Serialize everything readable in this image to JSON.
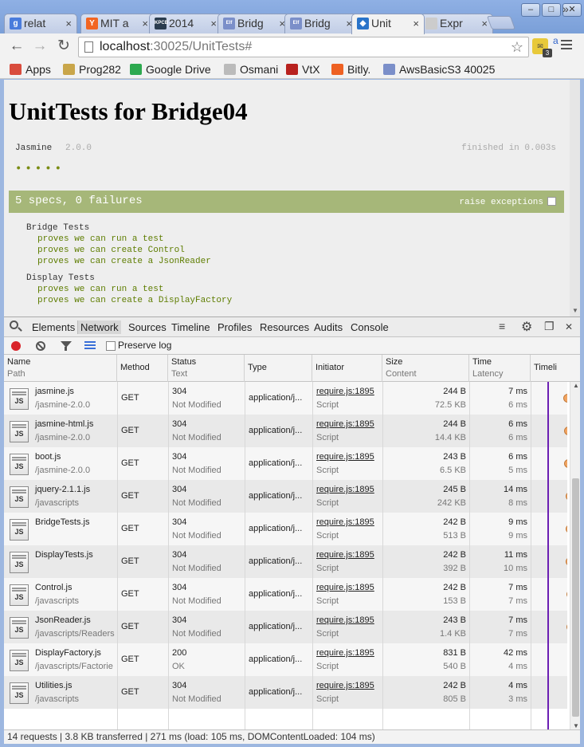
{
  "window": {
    "minimize_glyph": "–",
    "maximize_glyph": "□",
    "close_glyph": "✕"
  },
  "tabs": [
    {
      "label": "relat",
      "favicon": "g",
      "favicon_color": "#4a7cdc",
      "active": false
    },
    {
      "label": "MIT a",
      "favicon": "Y",
      "favicon_color": "#f26522",
      "active": false
    },
    {
      "label": "2014",
      "favicon": "KPCB",
      "favicon_color": "#2b3d4f",
      "active": false
    },
    {
      "label": "Bridg",
      "favicon": "Elf",
      "favicon_color": "#7b8fc9",
      "active": false
    },
    {
      "label": "Bridg",
      "favicon": "Elf",
      "favicon_color": "#7b8fc9",
      "active": false
    },
    {
      "label": "Unit",
      "favicon": "◆",
      "favicon_color": "#2a74c9",
      "active": true
    },
    {
      "label": "Expr",
      "favicon": "",
      "favicon_color": "#cccccc",
      "active": false
    }
  ],
  "address": {
    "host": "localhost",
    "path": ":30025/UnitTests#"
  },
  "extension": {
    "badge": "3"
  },
  "bookmarks": [
    {
      "label": "Apps",
      "icon": "apps-icon",
      "color": "#d94c3d"
    },
    {
      "label": "Prog282",
      "icon": "folder-icon",
      "color": "#c9a64a"
    },
    {
      "label": "Google Drive",
      "icon": "drive-icon",
      "color": "#2da94f"
    },
    {
      "label": "Osmani",
      "icon": "page-icon",
      "color": "#bbbbbb"
    },
    {
      "label": "VtX",
      "icon": "vtx-icon",
      "color": "#b8211e"
    },
    {
      "label": "Bitly.",
      "icon": "bitly-icon",
      "color": "#ee6123"
    },
    {
      "label": "AwsBasicS3 40025",
      "icon": "elf-icon",
      "color": "#7b8fc9"
    }
  ],
  "bookmarks_more": "»",
  "jasmine": {
    "title": "UnitTests for Bridge04",
    "name": "Jasmine",
    "version": "2.0.0",
    "duration": "finished in 0.003s",
    "dots": "•••••",
    "summary": "5 specs, 0 failures",
    "raise_label": "raise exceptions",
    "suites": [
      {
        "name": "Bridge Tests",
        "specs": [
          "proves we can run a test",
          "proves we can create Control",
          "proves we can create a JsonReader"
        ]
      },
      {
        "name": "Display Tests",
        "specs": [
          "proves we can run a test",
          "proves we can create a DisplayFactory"
        ]
      }
    ]
  },
  "devtools": {
    "tabs": [
      "Elements",
      "Network",
      "Sources",
      "Timeline",
      "Profiles",
      "Resources",
      "Audits",
      "Console"
    ],
    "active_tab": "Network",
    "preserve_log": "Preserve log",
    "columns": {
      "name": "Name",
      "path": "Path",
      "method": "Method",
      "status": "Status",
      "text": "Text",
      "type": "Type",
      "initiator": "Initiator",
      "size": "Size",
      "content": "Content",
      "time": "Time",
      "latency": "Latency",
      "timeline": "Timeli"
    },
    "rows": [
      {
        "name": "jasmine.js",
        "path": "/jasmine-2.0.0",
        "method": "GET",
        "status": "304",
        "text": "Not Modified",
        "type": "application/j...",
        "initiator": "require.js:1895",
        "initiator_type": "Script",
        "size": "244 B",
        "content": "72.5 KB",
        "time": "7 ms",
        "latency": "6 ms"
      },
      {
        "name": "jasmine-html.js",
        "path": "/jasmine-2.0.0",
        "method": "GET",
        "status": "304",
        "text": "Not Modified",
        "type": "application/j...",
        "initiator": "require.js:1895",
        "initiator_type": "Script",
        "size": "244 B",
        "content": "14.4 KB",
        "time": "6 ms",
        "latency": "6 ms"
      },
      {
        "name": "boot.js",
        "path": "/jasmine-2.0.0",
        "method": "GET",
        "status": "304",
        "text": "Not Modified",
        "type": "application/j...",
        "initiator": "require.js:1895",
        "initiator_type": "Script",
        "size": "243 B",
        "content": "6.5 KB",
        "time": "6 ms",
        "latency": "5 ms"
      },
      {
        "name": "jquery-2.1.1.js",
        "path": "/javascripts",
        "method": "GET",
        "status": "304",
        "text": "Not Modified",
        "type": "application/j...",
        "initiator": "require.js:1895",
        "initiator_type": "Script",
        "size": "245 B",
        "content": "242 KB",
        "time": "14 ms",
        "latency": "8 ms"
      },
      {
        "name": "BridgeTests.js",
        "path": "",
        "method": "GET",
        "status": "304",
        "text": "Not Modified",
        "type": "application/j...",
        "initiator": "require.js:1895",
        "initiator_type": "Script",
        "size": "242 B",
        "content": "513 B",
        "time": "9 ms",
        "latency": "9 ms"
      },
      {
        "name": "DisplayTests.js",
        "path": "",
        "method": "GET",
        "status": "304",
        "text": "Not Modified",
        "type": "application/j...",
        "initiator": "require.js:1895",
        "initiator_type": "Script",
        "size": "242 B",
        "content": "392 B",
        "time": "11 ms",
        "latency": "10 ms"
      },
      {
        "name": "Control.js",
        "path": "/javascripts",
        "method": "GET",
        "status": "304",
        "text": "Not Modified",
        "type": "application/j...",
        "initiator": "require.js:1895",
        "initiator_type": "Script",
        "size": "242 B",
        "content": "153 B",
        "time": "7 ms",
        "latency": "7 ms"
      },
      {
        "name": "JsonReader.js",
        "path": "/javascripts/Readers",
        "method": "GET",
        "status": "304",
        "text": "Not Modified",
        "type": "application/j...",
        "initiator": "require.js:1895",
        "initiator_type": "Script",
        "size": "243 B",
        "content": "1.4 KB",
        "time": "7 ms",
        "latency": "7 ms"
      },
      {
        "name": "DisplayFactory.js",
        "path": "/javascripts/Factorie",
        "method": "GET",
        "status": "200",
        "text": "OK",
        "type": "application/j...",
        "initiator": "require.js:1895",
        "initiator_type": "Script",
        "size": "831 B",
        "content": "540 B",
        "time": "42 ms",
        "latency": "4 ms"
      },
      {
        "name": "Utilities.js",
        "path": "/javascripts",
        "method": "GET",
        "status": "304",
        "text": "Not Modified",
        "type": "application/j...",
        "initiator": "require.js:1895",
        "initiator_type": "Script",
        "size": "242 B",
        "content": "805 B",
        "time": "4 ms",
        "latency": "3 ms"
      }
    ],
    "status_bar": "14 requests  |  3.8 KB transferred  |  271 ms (load: 105 ms, DOMContentLoaded: 104 ms)"
  }
}
